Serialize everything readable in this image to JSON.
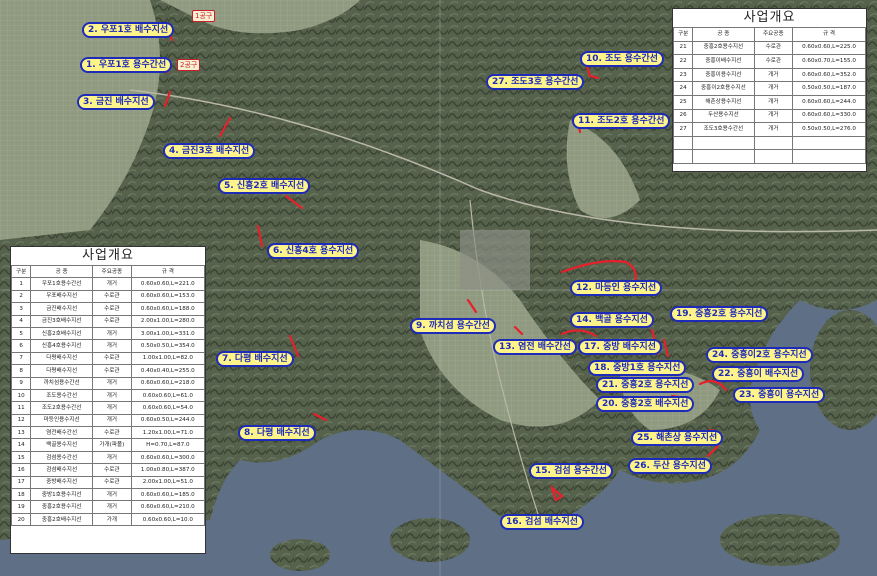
{
  "colors": {
    "label_bg": "#fff48a",
    "label_border": "#1d2bb8",
    "route": "#e8202c",
    "sea": "#5f6f85",
    "land": "#59654e",
    "fields": "#8f9a80"
  },
  "map_labels": [
    "2. 우포1호 배수지선",
    "1. 우포1호 용수간선",
    "3. 금진 배수지선",
    "4. 금진3호 배수지선",
    "5. 신흥2호 배수지선",
    "6. 신흥4호 용수지선",
    "7. 다평 배수지선",
    "8. 다평 배수지선",
    "9. 까치섬 용수간선",
    "10. 조도 용수간선",
    "11. 조도2호 용수간선",
    "27. 조도3호 용수간선",
    "12. 마등인 용수지선",
    "13. 염전 배수간선",
    "14. 백골 용수지선",
    "15. 검섬 용수간선",
    "16. 검섬 배수지선",
    "17. 중방 배수지선",
    "18. 중방1호 용수지선",
    "19. 중흥2호 용수지선",
    "20. 중흥2호 배수지선",
    "21. 중흥2호 용수지선",
    "22. 중흥이 배수지선",
    "23. 중흥이 용수지선",
    "24. 중흥이2호 용수지선",
    "25. 해촌상 용수지선",
    "26. 두산 용수지선"
  ],
  "small_tags": [
    "1공구",
    "2공구"
  ],
  "left_panel": {
    "title": "사업개요",
    "headers": [
      "구분",
      "공 종",
      "주요공종",
      "규 격"
    ],
    "rows": [
      [
        "1",
        "우포1호용수간선",
        "개거",
        "0.60x0.60,L=221.0"
      ],
      [
        "2",
        "우포배수지선",
        "수로관",
        "0.60x0.60,L=153.0"
      ],
      [
        "3",
        "금진배수지선",
        "수로관",
        "0.60x0.60,L=188.0"
      ],
      [
        "4",
        "금진3호배수지선",
        "수로관",
        "2.00x1.00,L=280.0"
      ],
      [
        "5",
        "신흥2호배수지선",
        "개거",
        "3.00x1.00,L=331.0"
      ],
      [
        "6",
        "신흥4호용수지선",
        "개거",
        "0.50x0.50,L=354.0"
      ],
      [
        "7",
        "다평배수지선",
        "수로관",
        "1.00x1.00,L=82.0"
      ],
      [
        "8",
        "다평배수지선",
        "수로관",
        "0.40x0.40,L=255.0"
      ],
      [
        "9",
        "까치섬용수간선",
        "개거",
        "0.60x0.60,L=218.0"
      ],
      [
        "10",
        "조도용수간선",
        "개거",
        "0.60x0.60,L=61.0"
      ],
      [
        "11",
        "조도2호용수간선",
        "개거",
        "0.60x0.60,L=54.0"
      ],
      [
        "12",
        "마등인용수지선",
        "개거",
        "0.60x0.50,L=244.0"
      ],
      [
        "13",
        "염전배수간선",
        "수로관",
        "1.20x1.00,L=71.0"
      ],
      [
        "14",
        "백골용수지선",
        "가개(파폴)",
        "H=0.70,L=87.0"
      ],
      [
        "15",
        "검섬용수간선",
        "개거",
        "0.60x0.60,L=300.0"
      ],
      [
        "16",
        "검섬배수지선",
        "수로관",
        "1.00x0.80,L=387.0"
      ],
      [
        "17",
        "중방배수지선",
        "수로관",
        "2.00x1.00,L=51.0"
      ],
      [
        "18",
        "중방1호용수지선",
        "개거",
        "0.60x0.60,L=185.0"
      ],
      [
        "19",
        "중흥2호용수지선",
        "개거",
        "0.60x0.60,L=210.0"
      ],
      [
        "20",
        "중흥2호배수지선",
        "가개",
        "0.60x0.60,L=10.0"
      ]
    ]
  },
  "right_panel": {
    "title": "사업개요",
    "headers": [
      "구분",
      "공 종",
      "주요공종",
      "규 격"
    ],
    "rows": [
      [
        "21",
        "중흥2호용수지선",
        "수로관",
        "0.60x0.60,L=225.0"
      ],
      [
        "22",
        "중흥이배수지선",
        "수로관",
        "0.60x0.70,L=155.0"
      ],
      [
        "23",
        "중흥이용수지선",
        "개거",
        "0.60x0.60,L=352.0"
      ],
      [
        "24",
        "중흥이2호용수지선",
        "개거",
        "0.50x0.50,L=187.0"
      ],
      [
        "25",
        "해촌상용수지선",
        "개거",
        "0.60x0.60,L=244.0"
      ],
      [
        "26",
        "두산용수지선",
        "개거",
        "0.60x0.60,L=330.0"
      ],
      [
        "27",
        "조도3호용수간선",
        "개거",
        "0.50x0.50,L=276.0"
      ],
      [
        "",
        "",
        "",
        ""
      ],
      [
        "",
        "",
        "",
        ""
      ]
    ]
  }
}
